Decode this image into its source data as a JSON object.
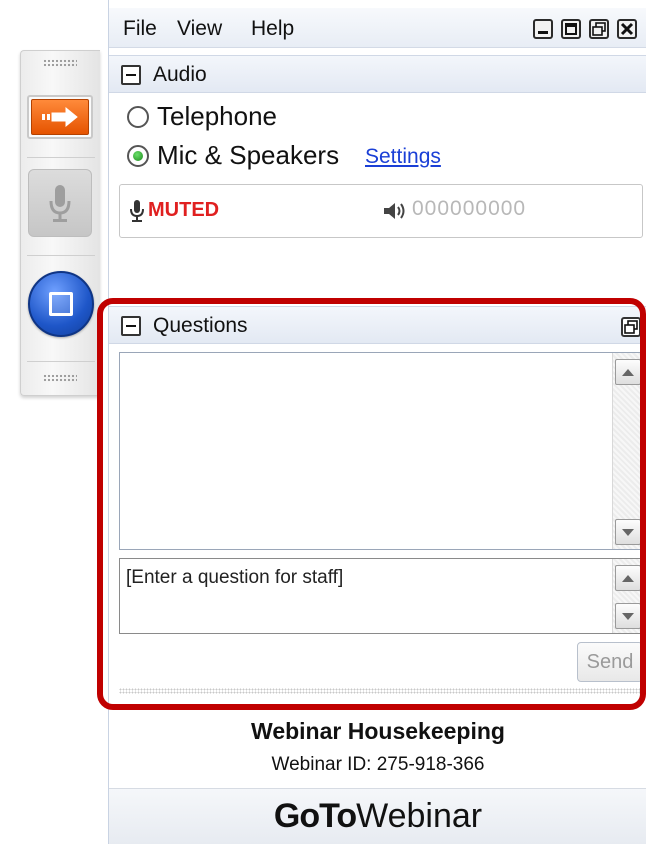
{
  "menu": {
    "file": "File",
    "view": "View",
    "help": "Help"
  },
  "audio": {
    "title": "Audio",
    "options": [
      {
        "label": "Telephone",
        "selected": false
      },
      {
        "label": "Mic & Speakers",
        "selected": true
      }
    ],
    "settings_link": "Settings",
    "mic_status": "MUTED",
    "speaker_level": "000000000"
  },
  "questions": {
    "title": "Questions",
    "input_placeholder": "[Enter a question for staff]",
    "send_label": "Send"
  },
  "footer": {
    "title": "Webinar Housekeeping",
    "webinar_id": "Webinar ID: 275-918-366",
    "brand_bold": "GoTo",
    "brand_regular": "Webinar"
  },
  "colors": {
    "highlight": "#c00000",
    "muted": "#e02020",
    "link": "#1a3fd6",
    "accent_orange": "#e55300",
    "stop_blue": "#1e56c8"
  },
  "icons": {
    "arrow": "arrow-right-icon",
    "mic": "microphone-icon",
    "stop": "stop-icon",
    "speaker": "speaker-icon"
  }
}
